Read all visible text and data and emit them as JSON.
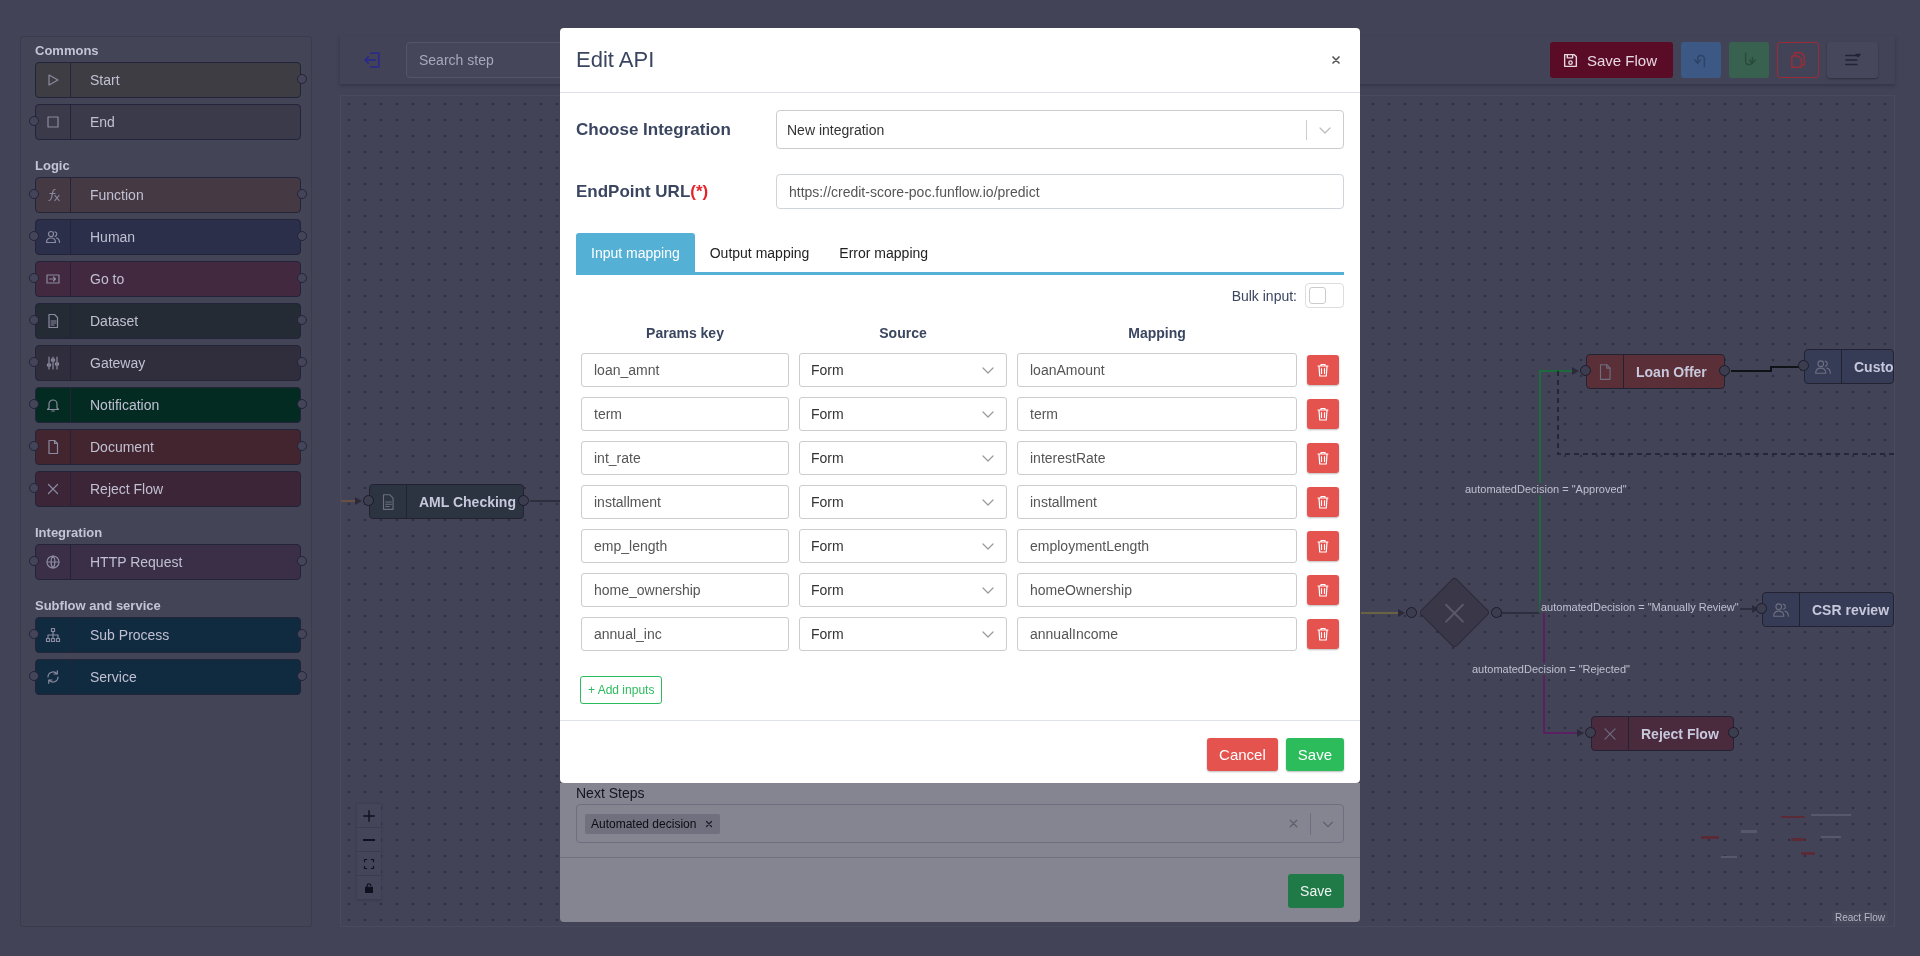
{
  "sidebar": {
    "groups": [
      {
        "title": "Commons",
        "items": [
          {
            "label": "Start",
            "kind": "start",
            "color": "#3d3d43"
          },
          {
            "label": "End",
            "kind": "end",
            "color": "#3a3a4b"
          }
        ]
      },
      {
        "title": "Logic",
        "items": [
          {
            "label": "Function",
            "kind": "function",
            "color": "#453a44"
          },
          {
            "label": "Human",
            "kind": "human",
            "color": "#2b2f4a"
          },
          {
            "label": "Go to",
            "kind": "goto",
            "color": "#43293f"
          },
          {
            "label": "Dataset",
            "kind": "dataset",
            "color": "#252b35"
          },
          {
            "label": "Gateway",
            "kind": "gateway",
            "color": "#302e3c"
          },
          {
            "label": "Notification",
            "kind": "notification",
            "color": "#032b22"
          },
          {
            "label": "Document",
            "kind": "document",
            "color": "#432530"
          },
          {
            "label": "Reject Flow",
            "kind": "reject",
            "color": "#3c2537"
          }
        ]
      },
      {
        "title": "Integration",
        "items": [
          {
            "label": "HTTP Request",
            "kind": "http",
            "color": "#3a2f47"
          }
        ]
      },
      {
        "title": "Subflow and service",
        "items": [
          {
            "label": "Sub Process",
            "kind": "subprocess",
            "color": "#102a40"
          },
          {
            "label": "Service",
            "kind": "service",
            "color": "#102a40"
          }
        ]
      }
    ]
  },
  "toolbar": {
    "search": {
      "placeholder": "Search step"
    },
    "buttons": [
      {
        "kind": "save",
        "label": "Save Flow"
      },
      {
        "kind": "undo"
      },
      {
        "kind": "redo"
      },
      {
        "kind": "copy"
      },
      {
        "kind": "menu"
      }
    ]
  },
  "canvas": {
    "nodes": [
      {
        "label": "AML Checking",
        "kind": "dataset",
        "color": "#2b3440"
      },
      {
        "kind": "gateway"
      },
      {
        "label": "Loan Offer",
        "kind": "document",
        "color": "#5a2f37"
      },
      {
        "label": "Custo",
        "kind": "human",
        "color": "#363c56"
      },
      {
        "label": "CSR review",
        "kind": "human",
        "color": "#363c56"
      },
      {
        "label": "Reject Flow",
        "kind": "reject",
        "color": "#4a2b3e"
      }
    ],
    "edge_labels": [
      "automatedDecision = \"Approved\"",
      "automatedDecision = \"Manually Review\"",
      "automatedDecision = \"Rejected\""
    ],
    "attribution": "React Flow"
  },
  "drawer": {
    "label": "Next Steps",
    "tags": [
      "Automated decision"
    ],
    "save": "Save"
  },
  "modal": {
    "title": "Edit API",
    "integration": {
      "label": "Choose Integration",
      "value": "New integration"
    },
    "endpoint": {
      "label": "EndPoint URL",
      "required_mark": "(*)",
      "value": "https://credit-score-poc.funflow.io/predict"
    },
    "tabs": [
      {
        "label": "Input mapping",
        "selected": true
      },
      {
        "label": "Output mapping",
        "selected": false
      },
      {
        "label": "Error mapping",
        "selected": false
      }
    ],
    "bulk_input": {
      "label": "Bulk input:",
      "on": false
    },
    "columns": [
      "Params key",
      "Source",
      "Mapping"
    ],
    "rows": [
      {
        "key": "loan_amnt",
        "source": "Form",
        "mapping": "loanAmount"
      },
      {
        "key": "term",
        "source": "Form",
        "mapping": "term"
      },
      {
        "key": "int_rate",
        "source": "Form",
        "mapping": "interestRate"
      },
      {
        "key": "installment",
        "source": "Form",
        "mapping": "installment"
      },
      {
        "key": "emp_length",
        "source": "Form",
        "mapping": "employmentLength"
      },
      {
        "key": "home_ownership",
        "source": "Form",
        "mapping": "homeOwnership"
      },
      {
        "key": "annual_inc",
        "source": "Form",
        "mapping": "annualIncome"
      }
    ],
    "add_button": "+ Add inputs",
    "buttons": [
      {
        "kind": "cancel",
        "label": "Cancel"
      },
      {
        "kind": "save",
        "label": "Save"
      }
    ]
  }
}
